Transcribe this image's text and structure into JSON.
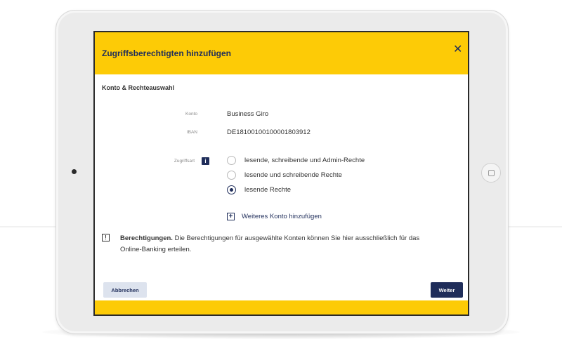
{
  "dialog": {
    "title": "Zugriffsberechtigten hinzufügen",
    "close_icon": "close-icon",
    "close_symbol": "✕"
  },
  "section": {
    "title": "Konto & Rechteauswahl"
  },
  "account": {
    "konto_label": "Konto",
    "konto_value": "Business Giro",
    "iban_label": "IBAN",
    "iban_value": "DE18100100100001803912"
  },
  "access": {
    "label": "Zugriffsart",
    "info_icon": "info-icon",
    "info_symbol": "i",
    "options": [
      {
        "label": "lesende, schreibende und Admin-Rechte",
        "checked": false
      },
      {
        "label": "lesende und schreibende Rechte",
        "checked": false
      },
      {
        "label": "lesende Rechte",
        "checked": true
      }
    ]
  },
  "add_account": {
    "icon": "plus-square-icon",
    "symbol": "+",
    "label": "Weiteres Konto hinzufügen"
  },
  "notice": {
    "icon": "notice-icon",
    "symbol": "!",
    "bold": "Berechtigungen.",
    "text": " Die Berechtigungen für ausgewählte Konten können Sie hier ausschließlich für das Online-Banking erteilen."
  },
  "buttons": {
    "cancel": "Abbrechen",
    "next": "Weiter"
  },
  "colors": {
    "brand_yellow": "#fdcb06",
    "brand_navy": "#1f2d5a",
    "cancel_bg": "#dde3ee"
  }
}
